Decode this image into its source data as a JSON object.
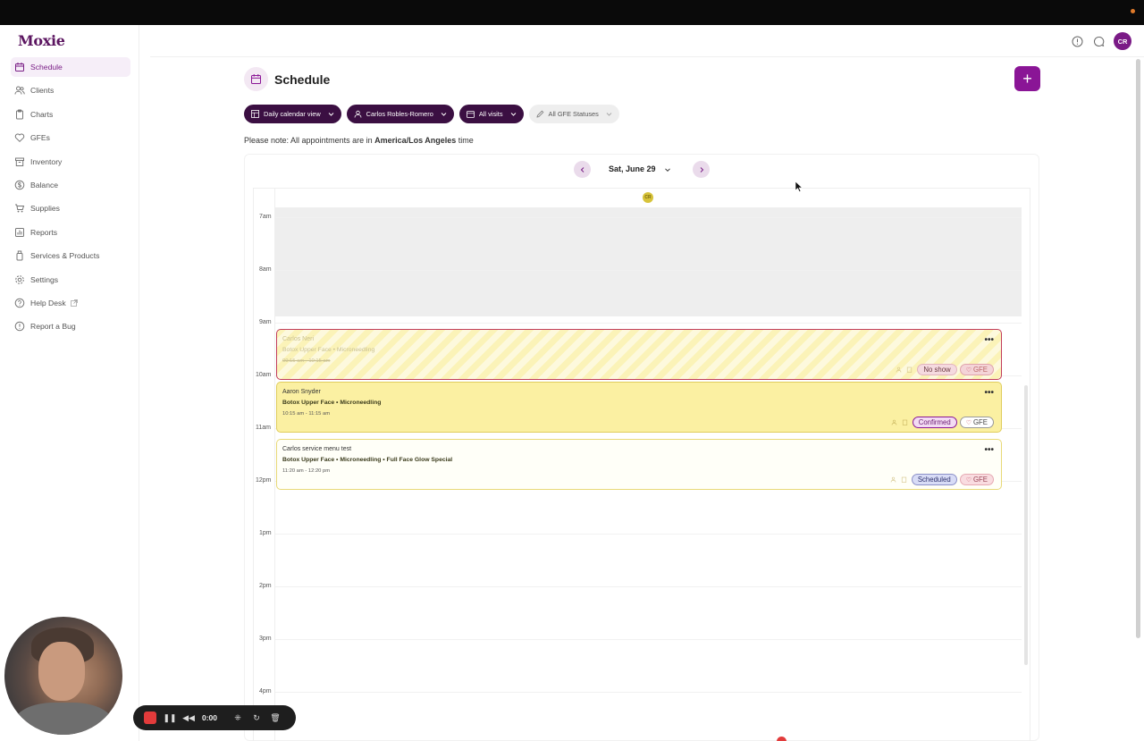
{
  "app": {
    "logo": "Moxie"
  },
  "sidebar": {
    "items": [
      {
        "label": "Schedule",
        "icon": "calendar-icon",
        "active": true
      },
      {
        "label": "Clients",
        "icon": "users-icon"
      },
      {
        "label": "Charts",
        "icon": "clipboard-icon"
      },
      {
        "label": "GFEs",
        "icon": "heart-icon"
      },
      {
        "label": "Inventory",
        "icon": "box-icon"
      },
      {
        "label": "Balance",
        "icon": "dollar-icon"
      },
      {
        "label": "Supplies",
        "icon": "cart-icon"
      },
      {
        "label": "Reports",
        "icon": "chart-icon"
      },
      {
        "label": "Services & Products",
        "icon": "bottle-icon"
      },
      {
        "label": "Settings",
        "icon": "gear-icon"
      },
      {
        "label": "Help Desk",
        "icon": "help-icon",
        "external": true
      },
      {
        "label": "Report a Bug",
        "icon": "alert-icon"
      }
    ]
  },
  "header": {
    "avatar_initials": "CR"
  },
  "page": {
    "title": "Schedule",
    "add_label": "+",
    "filters": [
      {
        "label": "Daily calendar view",
        "icon": "grid-icon"
      },
      {
        "label": "Carlos Robles-Romero",
        "icon": "person-icon"
      },
      {
        "label": "All visits",
        "icon": "visits-icon"
      },
      {
        "label": "All GFE Statuses",
        "icon": "pen-icon"
      }
    ],
    "note_prefix": "Please note: All appointments are in ",
    "note_tz": "America/Los Angeles",
    "note_suffix": " time"
  },
  "calendar": {
    "date_label": "Sat, June 29",
    "column_avatar": "CR",
    "hours": [
      "7am",
      "8am",
      "9am",
      "10am",
      "11am",
      "12pm",
      "1pm",
      "2pm",
      "3pm",
      "4pm"
    ],
    "appointments": [
      {
        "client": "Carlos Neri",
        "services": "Botox Upper Face • Microneedling",
        "time": "09:15 am - 10:15 am",
        "status": "No show",
        "gfe": "GFE"
      },
      {
        "client": "Aaron Snyder",
        "services": "Botox Upper Face • Microneedling",
        "time": "10:15 am - 11:15 am",
        "status": "Confirmed",
        "gfe": "GFE"
      },
      {
        "client": "Carlos service menu test",
        "services": "Botox Upper Face • Microneedling • Full Face Glow Special",
        "time": "11:20 am - 12:20 pm",
        "status": "Scheduled",
        "gfe": "GFE"
      }
    ]
  },
  "recorder": {
    "timer": "0:00"
  },
  "colors": {
    "brand": "#8a1596",
    "brand_dark": "#3b0f42",
    "no_show": "#c23d5a",
    "confirmed_bg": "#fbf0a2"
  }
}
